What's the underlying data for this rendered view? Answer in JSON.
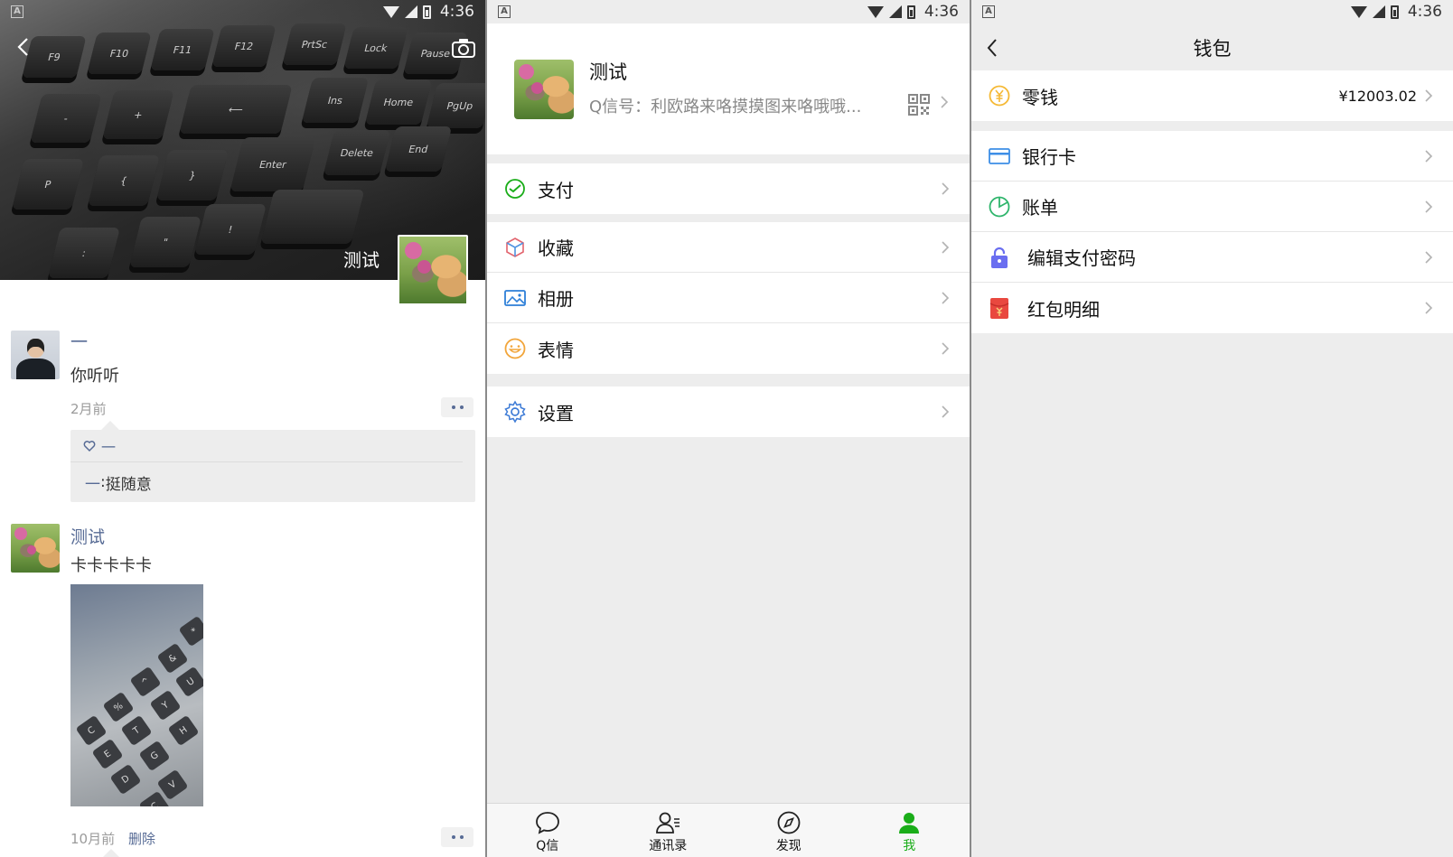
{
  "status_bar": {
    "time": "4:36",
    "notification_glyph": "A"
  },
  "moments": {
    "cover_name": "测试",
    "posts": [
      {
        "author": "一",
        "text": "你听听",
        "time": "2月前",
        "likes": "一",
        "comment_author": "一",
        "comment_sep": ": ",
        "comment_text": "挺随意"
      },
      {
        "author": "测试",
        "text": "卡卡卡卡卡",
        "time": "10月前",
        "delete_label": "删除"
      }
    ]
  },
  "me": {
    "name": "测试",
    "qid": "Q信号：利欧路来咯摸摸图来咯哦哦...",
    "menu": [
      {
        "label": "支付",
        "icon": "payment-icon"
      },
      {
        "label": "收藏",
        "icon": "favorites-cube-icon"
      },
      {
        "label": "相册",
        "icon": "album-icon"
      },
      {
        "label": "表情",
        "icon": "emoji-icon"
      },
      {
        "label": "设置",
        "icon": "settings-gear-icon"
      }
    ],
    "tabs": [
      {
        "label": "Q信",
        "icon": "chat-bubble-icon"
      },
      {
        "label": "通讯录",
        "icon": "contacts-icon"
      },
      {
        "label": "发现",
        "icon": "compass-icon"
      },
      {
        "label": "我",
        "icon": "person-icon"
      }
    ],
    "active_tab_color": "#1aad19"
  },
  "wallet": {
    "title": "钱包",
    "change": {
      "label": "零钱",
      "value": "¥12003.02",
      "icon": "yuan-coin-icon"
    },
    "items": [
      {
        "label": "银行卡",
        "icon": "bank-card-icon"
      },
      {
        "label": "账单",
        "icon": "bill-pie-icon"
      },
      {
        "label": "编辑支付密码",
        "icon": "lock-icon"
      },
      {
        "label": "红包明细",
        "icon": "red-packet-icon"
      }
    ]
  }
}
